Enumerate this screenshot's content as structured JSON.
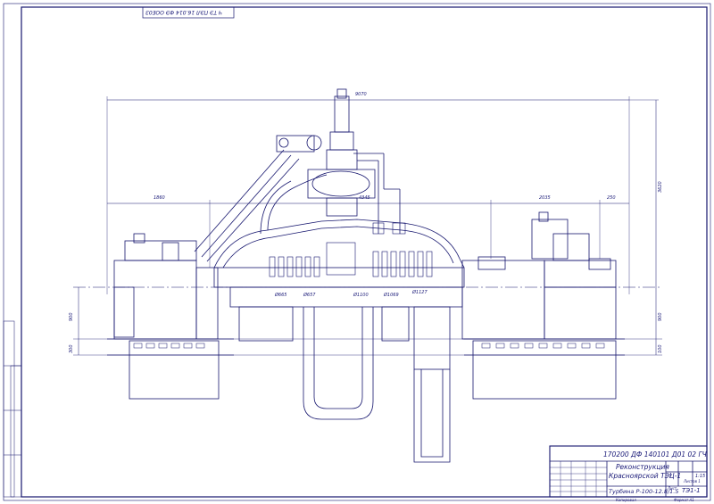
{
  "stamp": {
    "top_left": "Ч ТЭ ПЭЛ 16.014 ФЭ ООЕ0З",
    "designation": "170200 ДФ 140101 Д01 02 ГЧ",
    "title_line1": "Реконструкция",
    "title_line2": "Красноярской ТЭЦ-1",
    "drawing_name": "Турбина Р-100-12.8/1.5",
    "group": "ТЭ1-1",
    "scale": "1:15",
    "litera": "У",
    "sheet_label": "Лист",
    "sheets_label": "Листов 1",
    "copied": "Копировал",
    "format": "Формат А1"
  },
  "dimensions": {
    "overall_length": "9070",
    "height": "3620",
    "left_span": "1860",
    "center_span": "4345",
    "right_span": "2035",
    "right_small": "250",
    "left_lower": "900",
    "left_bottom": "300",
    "right_lower": "900",
    "right_bottom": "100"
  },
  "diameters": [
    "Ø665",
    "Ø657",
    "Ø1100",
    "Ø1069",
    "Ø1127"
  ],
  "colors": {
    "line": "#16166e",
    "paper": "#ffffff"
  }
}
